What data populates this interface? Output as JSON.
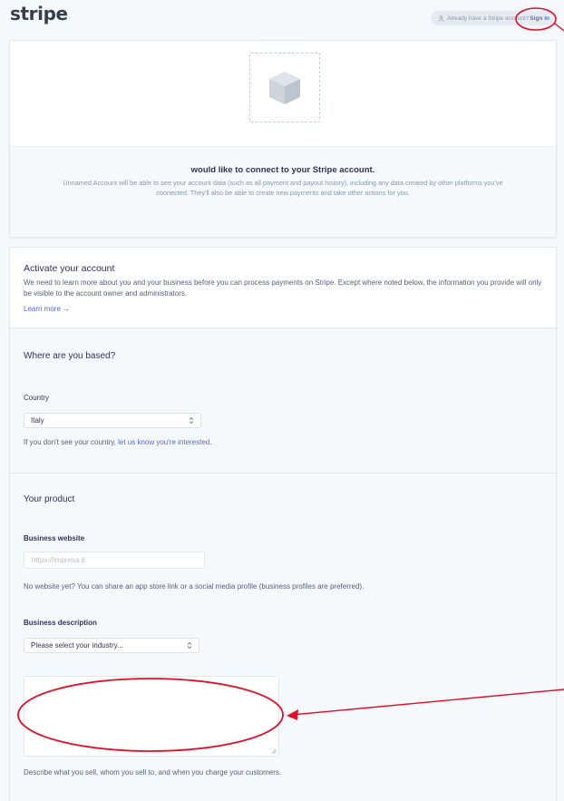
{
  "header": {
    "logo": "stripe",
    "signin_prompt": "Already have a Stripe account?",
    "signin_label": "Sign in"
  },
  "connect": {
    "title": "would like to connect to your Stripe account.",
    "description": "Unnamed Account will be able to see your account data (such as all payment and payout history), including any data created by other platforms you've connected. They'll also be able to create new payments and take other actions for you."
  },
  "activate": {
    "title": "Activate your account",
    "description": "We need to learn more about you and your business before you can process payments on Stripe. Except where noted below, the information you provide will only be visible to the account owner and administrators.",
    "learn_more": "Learn more →"
  },
  "based": {
    "title": "Where are you based?",
    "country_label": "Country",
    "country_value": "Italy",
    "helper_prefix": "If you don't see your country, ",
    "helper_link": "let us know you're interested",
    "helper_suffix": "."
  },
  "product": {
    "title": "Your product",
    "website_label": "Business website",
    "website_placeholder": "https://impresa.it",
    "website_helper": "No website yet? You can share an app store link or a social media profile (business profiles are preferred).",
    "description_label": "Business description",
    "industry_value": "Please select your industry...",
    "description_helper": "Describe what you sell, whom you sell to, and when you charge your customers."
  },
  "icons": {
    "person": "person-icon",
    "box": "box-icon",
    "chevron": "select-chevron-icon"
  },
  "colors": {
    "accent": "#5469d4",
    "annotation": "#e0102a"
  }
}
